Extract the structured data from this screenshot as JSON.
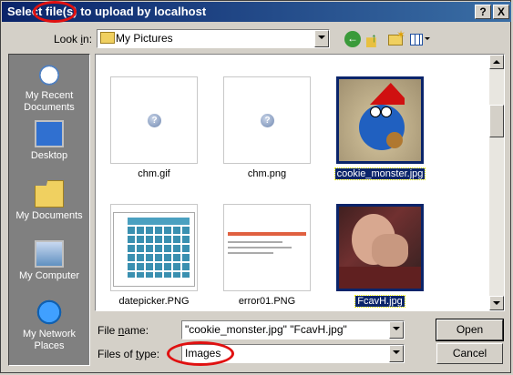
{
  "window": {
    "title": "Select file(s) to upload by localhost",
    "help_button": "?",
    "close_button": "X"
  },
  "toolbar": {
    "look_in_label": "Look in:",
    "look_in_value": "My Pictures",
    "icons": [
      "back-icon",
      "up-folder-icon",
      "new-folder-icon",
      "views-menu-icon"
    ]
  },
  "places": [
    {
      "label": "My Recent Documents",
      "icon": "recent-documents-icon"
    },
    {
      "label": "Desktop",
      "icon": "desktop-icon"
    },
    {
      "label": "My Documents",
      "icon": "my-documents-icon"
    },
    {
      "label": "My Computer",
      "icon": "my-computer-icon"
    },
    {
      "label": "My Network Places",
      "icon": "network-places-icon"
    }
  ],
  "files": [
    {
      "name": "chm.gif",
      "selected": false
    },
    {
      "name": "chm.png",
      "selected": false
    },
    {
      "name": "cookie_monster.jpg",
      "selected": true
    },
    {
      "name": "datepicker.PNG",
      "selected": false
    },
    {
      "name": "error01.PNG",
      "selected": false
    },
    {
      "name": "FcavH.jpg",
      "selected": true
    }
  ],
  "bottom": {
    "file_name_label": "File name:",
    "file_name_value": "\"cookie_monster.jpg\" \"FcavH.jpg\"",
    "file_type_label": "Files of type:",
    "file_type_value": "Images",
    "open_button": "Open",
    "cancel_button": "Cancel"
  },
  "colors": {
    "title_bar": "#0a246a",
    "annotation": "#e01010",
    "selection": "#0a246a"
  }
}
